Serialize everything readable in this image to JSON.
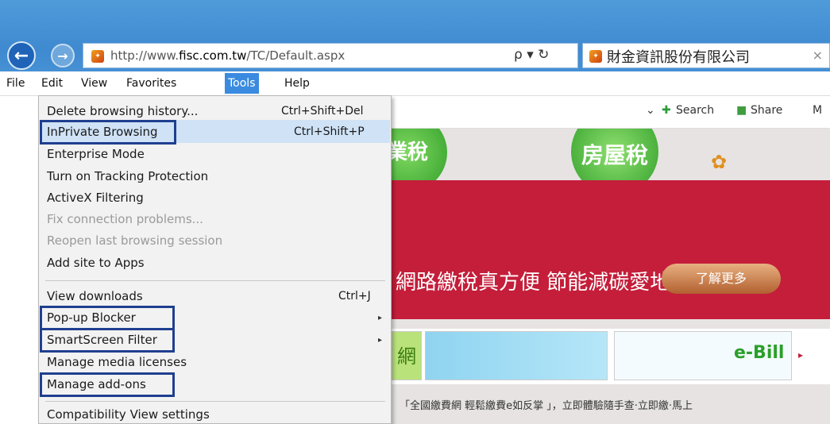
{
  "browser": {
    "address_url_prefix": "http://www.",
    "address_url_domain": "fisc.com.tw",
    "address_url_path": "/TC/Default.aspx",
    "address_controls": "ρ ▾ ↻",
    "tab_title": "財金資訊股份有限公司",
    "tab_close": "×"
  },
  "menubar": [
    "File",
    "Edit",
    "View",
    "Favorites",
    "Tools",
    "Help"
  ],
  "menubar_active": "Tools",
  "commandbar": {
    "dropdown": "⌄",
    "search_label": "Search",
    "share_label": "Share",
    "more_label": "M"
  },
  "tools_menu": {
    "items": [
      {
        "label": "Delete browsing history...",
        "shortcut": "Ctrl+Shift+Del"
      },
      {
        "label": "InPrivate Browsing",
        "shortcut": "Ctrl+Shift+P",
        "highlighted": true
      },
      {
        "label": "Enterprise Mode"
      },
      {
        "label": "Turn on Tracking Protection"
      },
      {
        "label": "ActiveX Filtering"
      },
      {
        "label": "Fix connection problems...",
        "disabled": true
      },
      {
        "label": "Reopen last browsing session",
        "disabled": true
      },
      {
        "label": "Add site to Apps"
      },
      {
        "label": "View downloads",
        "shortcut": "Ctrl+J"
      },
      {
        "label": "Pop-up Blocker",
        "submenu": true
      },
      {
        "label": "SmartScreen Filter",
        "submenu": true
      },
      {
        "label": "Manage media licenses"
      },
      {
        "label": "Manage add-ons"
      },
      {
        "label": "Compatibility View settings"
      }
    ],
    "submenu_arrow": "▸"
  },
  "page": {
    "ball1_text": "業稅",
    "ball2_text": "房屋稅",
    "slogan": "網路繳稅真方便 節能減碳愛地球",
    "learn_more": "了解更多",
    "tile1_text": "網",
    "tile3_text": "e-Bill",
    "tile_arrow": "▸",
    "ticker": "「全國繳費網 輕鬆繳費e如反掌 」，立即體驗隨手查‧立即繳‧馬上"
  },
  "colors": {
    "accent": "#3a8be0",
    "highlight_box": "#1f3f8f",
    "banner": "#c41e3a"
  }
}
